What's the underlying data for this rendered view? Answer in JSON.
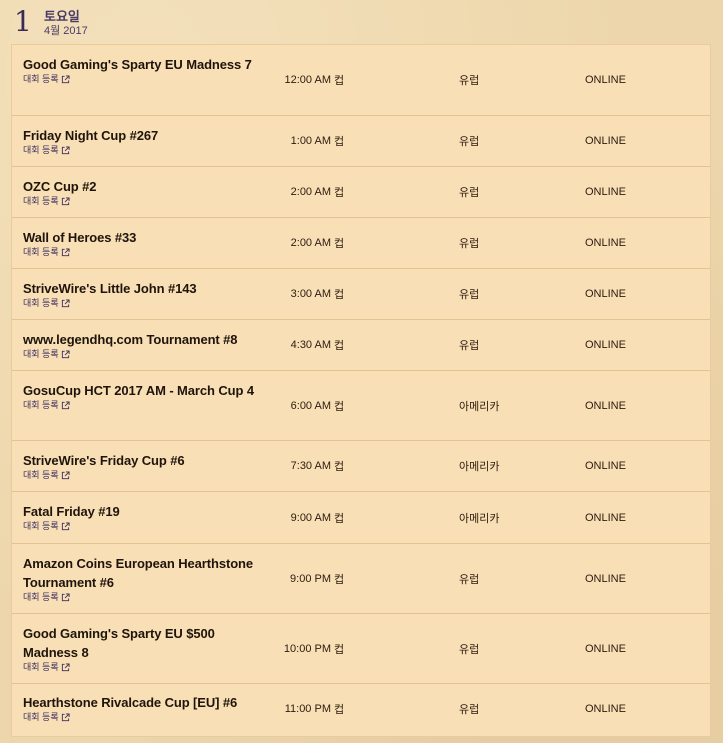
{
  "day": {
    "number": "1",
    "name": "토요일",
    "date": "4월 2017"
  },
  "register_label": "대회 등록",
  "icons": {
    "external_link": "external-link-icon"
  },
  "colors": {
    "background": "#edd6ab",
    "list_background": "#f9dfb5",
    "link": "#3b2f60"
  },
  "events": [
    {
      "name": "Good Gaming's Sparty EU Madness 7",
      "time": "12:00 AM",
      "type": "컵",
      "region": "유럽",
      "mode": "ONLINE"
    },
    {
      "name": "Friday Night Cup #267",
      "time": "1:00 AM",
      "type": "컵",
      "region": "유럽",
      "mode": "ONLINE"
    },
    {
      "name": "OZC Cup #2",
      "time": "2:00 AM",
      "type": "컵",
      "region": "유럽",
      "mode": "ONLINE"
    },
    {
      "name": "Wall of Heroes #33",
      "time": "2:00 AM",
      "type": "컵",
      "region": "유럽",
      "mode": "ONLINE"
    },
    {
      "name": "StriveWire's Little John #143",
      "time": "3:00 AM",
      "type": "컵",
      "region": "유럽",
      "mode": "ONLINE"
    },
    {
      "name": "www.legendhq.com Tournament #8",
      "time": "4:30 AM",
      "type": "컵",
      "region": "유럽",
      "mode": "ONLINE"
    },
    {
      "name": "GosuCup HCT 2017 AM - March Cup 4",
      "time": "6:00 AM",
      "type": "컵",
      "region": "아메리카",
      "mode": "ONLINE"
    },
    {
      "name": "StriveWire's Friday Cup #6",
      "time": "7:30 AM",
      "type": "컵",
      "region": "아메리카",
      "mode": "ONLINE"
    },
    {
      "name": "Fatal Friday #19",
      "time": "9:00 AM",
      "type": "컵",
      "region": "아메리카",
      "mode": "ONLINE"
    },
    {
      "name": "Amazon Coins European Hearthstone Tournament #6",
      "time": "9:00 PM",
      "type": "컵",
      "region": "유럽",
      "mode": "ONLINE"
    },
    {
      "name": "Good Gaming's Sparty EU $500 Madness 8",
      "time": "10:00 PM",
      "type": "컵",
      "region": "유럽",
      "mode": "ONLINE"
    },
    {
      "name": "Hearthstone Rivalcade Cup [EU] #6",
      "time": "11:00 PM",
      "type": "컵",
      "region": "유럽",
      "mode": "ONLINE"
    }
  ]
}
